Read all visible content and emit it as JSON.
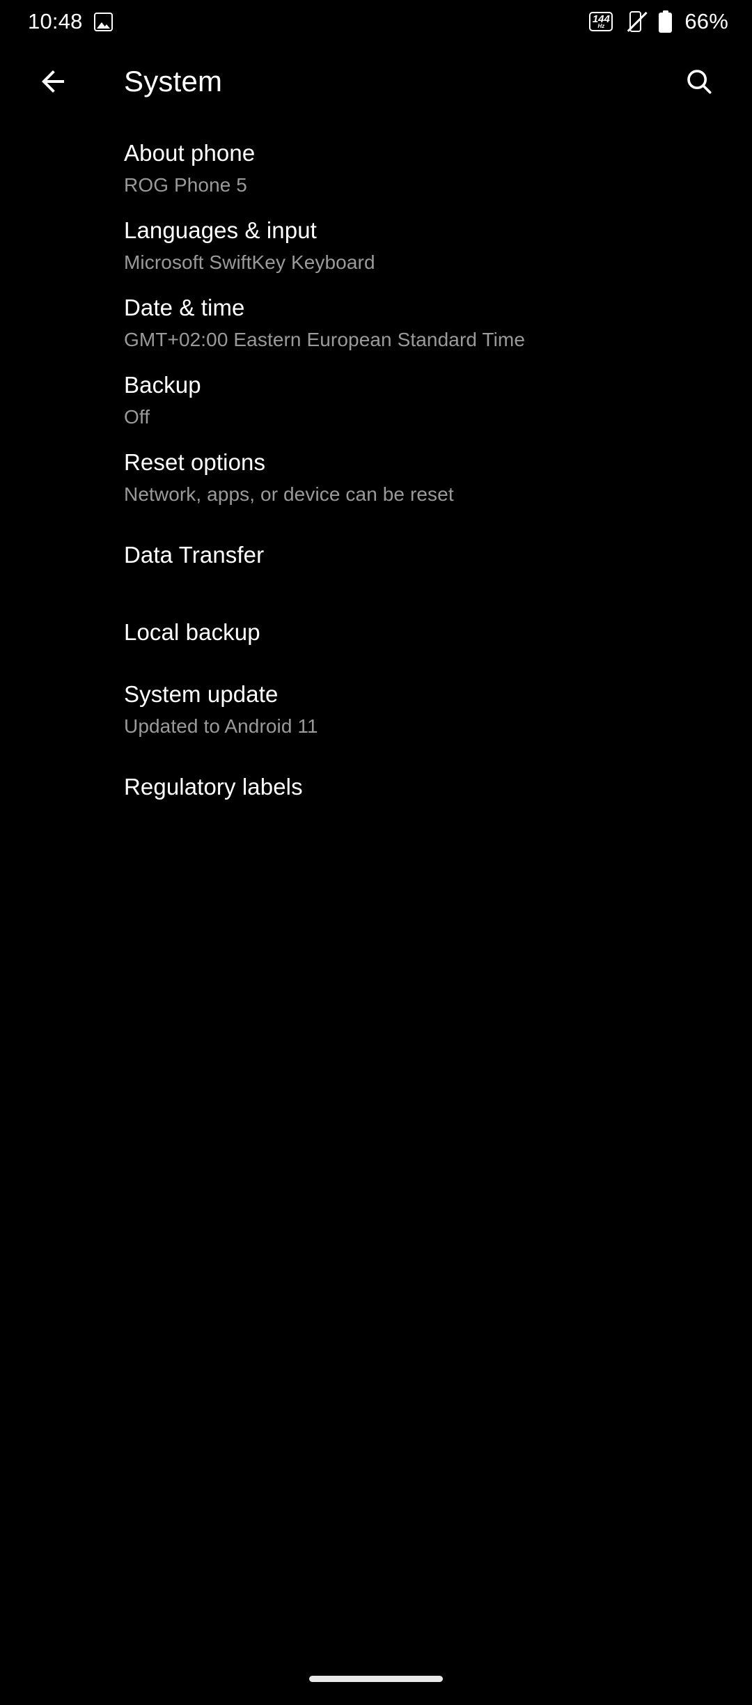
{
  "status_bar": {
    "time": "10:48",
    "photo_icon": "photo-icon",
    "refresh_rate_value": "144",
    "refresh_rate_unit": "Hz",
    "vibrate_icon": "vibrate-off-icon",
    "battery_icon": "battery-icon",
    "battery_percent": "66%"
  },
  "app_bar": {
    "back_icon": "back-arrow-icon",
    "title": "System",
    "search_icon": "search-icon"
  },
  "settings_list": [
    {
      "title": "About phone",
      "subtitle": "ROG Phone 5"
    },
    {
      "title": "Languages & input",
      "subtitle": "Microsoft SwiftKey Keyboard"
    },
    {
      "title": "Date & time",
      "subtitle": "GMT+02:00 Eastern European Standard Time"
    },
    {
      "title": "Backup",
      "subtitle": "Off"
    },
    {
      "title": "Reset options",
      "subtitle": "Network, apps, or device can be reset"
    },
    {
      "title": "Data Transfer",
      "subtitle": ""
    },
    {
      "title": "Local backup",
      "subtitle": ""
    },
    {
      "title": "System update",
      "subtitle": "Updated to Android 11"
    },
    {
      "title": "Regulatory labels",
      "subtitle": ""
    }
  ],
  "navigation": {
    "gesture_pill": "home-gesture-pill"
  },
  "colors": {
    "background": "#000000",
    "primary_text": "#ffffff",
    "secondary_text": "#9a9a9a",
    "pill": "#e8e8e8"
  }
}
